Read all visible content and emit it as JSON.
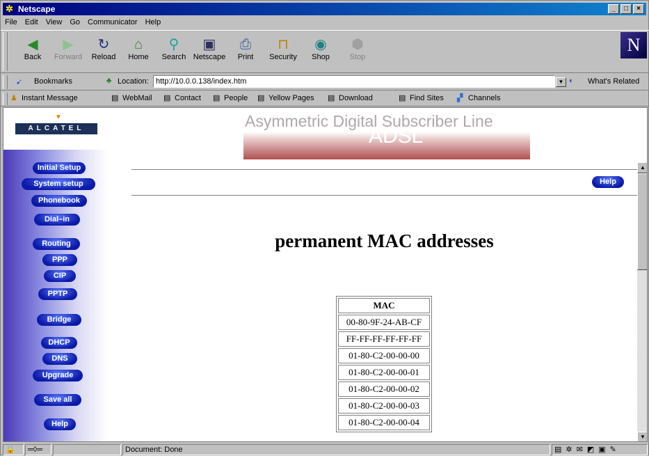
{
  "window": {
    "title": "Netscape"
  },
  "menu": [
    "File",
    "Edit",
    "View",
    "Go",
    "Communicator",
    "Help"
  ],
  "navbar": [
    {
      "label": "Back",
      "icon": "back-arrow-icon",
      "enabled": true
    },
    {
      "label": "Forward",
      "icon": "forward-arrow-icon",
      "enabled": false
    },
    {
      "label": "Reload",
      "icon": "reload-icon",
      "enabled": true
    },
    {
      "label": "Home",
      "icon": "home-icon",
      "enabled": true
    },
    {
      "label": "Search",
      "icon": "search-icon",
      "enabled": true
    },
    {
      "label": "Netscape",
      "icon": "netscape-icon",
      "enabled": true
    },
    {
      "label": "Print",
      "icon": "print-icon",
      "enabled": true
    },
    {
      "label": "Security",
      "icon": "lock-icon",
      "enabled": true
    },
    {
      "label": "Shop",
      "icon": "shop-icon",
      "enabled": true
    },
    {
      "label": "Stop",
      "icon": "stop-icon",
      "enabled": false
    }
  ],
  "location": {
    "bookmarks_label": "Bookmarks",
    "location_label": "Location:",
    "url": "http://10.0.0.138/index.htm",
    "related_label": "What's Related"
  },
  "personal_toolbar": [
    "Instant Message",
    "WebMail",
    "Contact",
    "People",
    "Yellow Pages",
    "Download",
    "Find Sites",
    "Channels"
  ],
  "page": {
    "logo_text": "ALCATEL",
    "banner_title": "Asymmetric Digital Subscriber Line",
    "banner_big": "ADSL",
    "help_label": "Help",
    "heading": "permanent MAC addresses",
    "table_header": "MAC",
    "mac_addresses": [
      "00-80-9F-24-AB-CF",
      "FF-FF-FF-FF-FF-FF",
      "01-80-C2-00-00-00",
      "01-80-C2-00-00-01",
      "01-80-C2-00-00-02",
      "01-80-C2-00-00-03",
      "01-80-C2-00-00-04"
    ]
  },
  "sidebar": [
    {
      "label": "Initial Setup"
    },
    {
      "label": "System setup"
    },
    {
      "label": "Phonebook"
    },
    {
      "label": "Dial–in"
    },
    {
      "label": "Routing"
    },
    {
      "label": "PPP"
    },
    {
      "label": "CIP"
    },
    {
      "label": "PPTP"
    },
    {
      "label": "Bridge"
    },
    {
      "label": "DHCP"
    },
    {
      "label": "DNS"
    },
    {
      "label": "Upgrade"
    },
    {
      "label": "Save all"
    },
    {
      "label": "Help"
    }
  ],
  "status": {
    "text": "Document: Done"
  }
}
